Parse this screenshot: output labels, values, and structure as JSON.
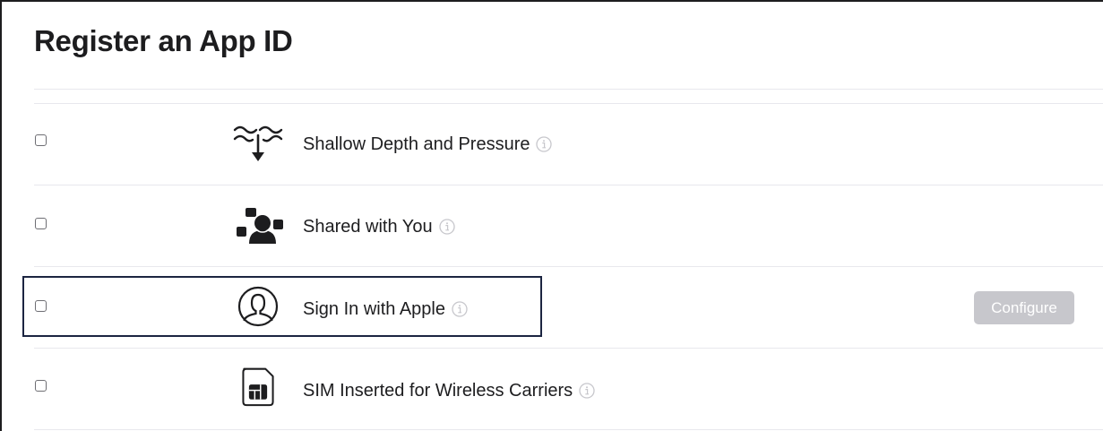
{
  "page": {
    "title": "Register an App ID"
  },
  "capabilities": [
    {
      "label": "Shallow Depth and Pressure",
      "icon": "depth-pressure-icon",
      "checked": false
    },
    {
      "label": "Shared with You",
      "icon": "shared-with-you-icon",
      "checked": false
    },
    {
      "label": "Sign In with Apple",
      "icon": "sign-in-with-apple-icon",
      "checked": false,
      "configure_label": "Configure"
    },
    {
      "label": "SIM Inserted for Wireless Carriers",
      "icon": "sim-card-icon",
      "checked": false
    }
  ],
  "colors": {
    "text": "#1d1d1f",
    "divider": "#e8e8ed",
    "info_icon": "#c7c7cc",
    "disabled_button": "#c7c7cc",
    "highlight_border": "#1c2541"
  }
}
